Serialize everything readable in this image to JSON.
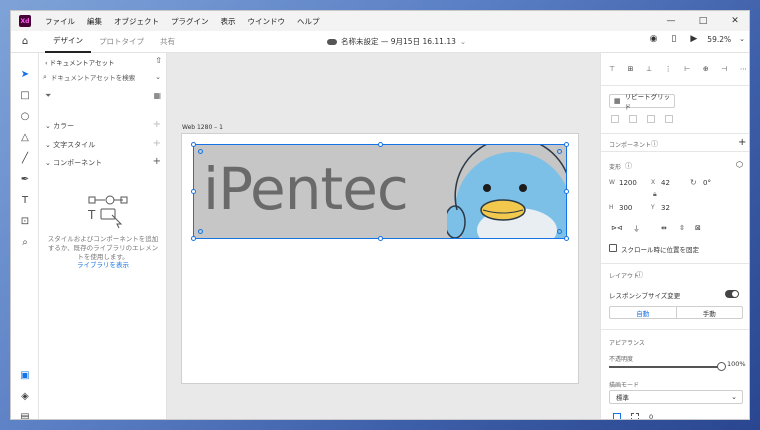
{
  "app": {
    "logo": "Xd",
    "menu": [
      "ファイル",
      "編集",
      "オブジェクト",
      "プラグイン",
      "表示",
      "ウインドウ",
      "ヘルプ"
    ],
    "window_controls": [
      "—",
      "□",
      "✕"
    ]
  },
  "toolbar": {
    "tabs": [
      {
        "label": "デザイン",
        "active": true
      },
      {
        "label": "プロトタイプ",
        "active": false
      },
      {
        "label": "共有",
        "active": false
      }
    ],
    "document_title": "名称未設定 — 9月15日 16.11.13",
    "zoom": "59.2%"
  },
  "assets": {
    "header": "ドキュメントアセット",
    "search_placeholder": "ドキュメントアセットを検索",
    "sections": [
      "カラー",
      "文字スタイル",
      "コンポーネント"
    ],
    "empty_message": "スタイルおよびコンポーネントを追加するか、既存のライブラリのエレメントを使用します。",
    "library_link": "ライブラリを表示"
  },
  "canvas": {
    "artboard_label": "Web 1280 – 1",
    "banner_text": "iPentec"
  },
  "properties": {
    "repeat_grid_label": "リピートグリッド",
    "component_label": "コンポーネント",
    "transform_label": "変形",
    "w_label": "W",
    "w_value": "1200",
    "x_label": "X",
    "x_value": "42",
    "h_label": "H",
    "h_value": "300",
    "y_label": "Y",
    "y_value": "32",
    "rotation_value": "0°",
    "fix_position_label": "スクロール時に位置を固定",
    "layout_label": "レイアウト",
    "responsive_label": "レスポンシブサイズ変更",
    "responsive_options": [
      "自動",
      "手動"
    ],
    "appearance_label": "アピアランス",
    "opacity_label": "不透明度",
    "opacity_value": "100%",
    "blend_label": "描画モード",
    "blend_value": "標準",
    "corner_value": "0"
  },
  "colors": {
    "accent": "#1473e6",
    "banner_bg": "#c6c6c6",
    "brand_text": "#6a6a6a",
    "penguin_blue": "#7cc0e8"
  }
}
